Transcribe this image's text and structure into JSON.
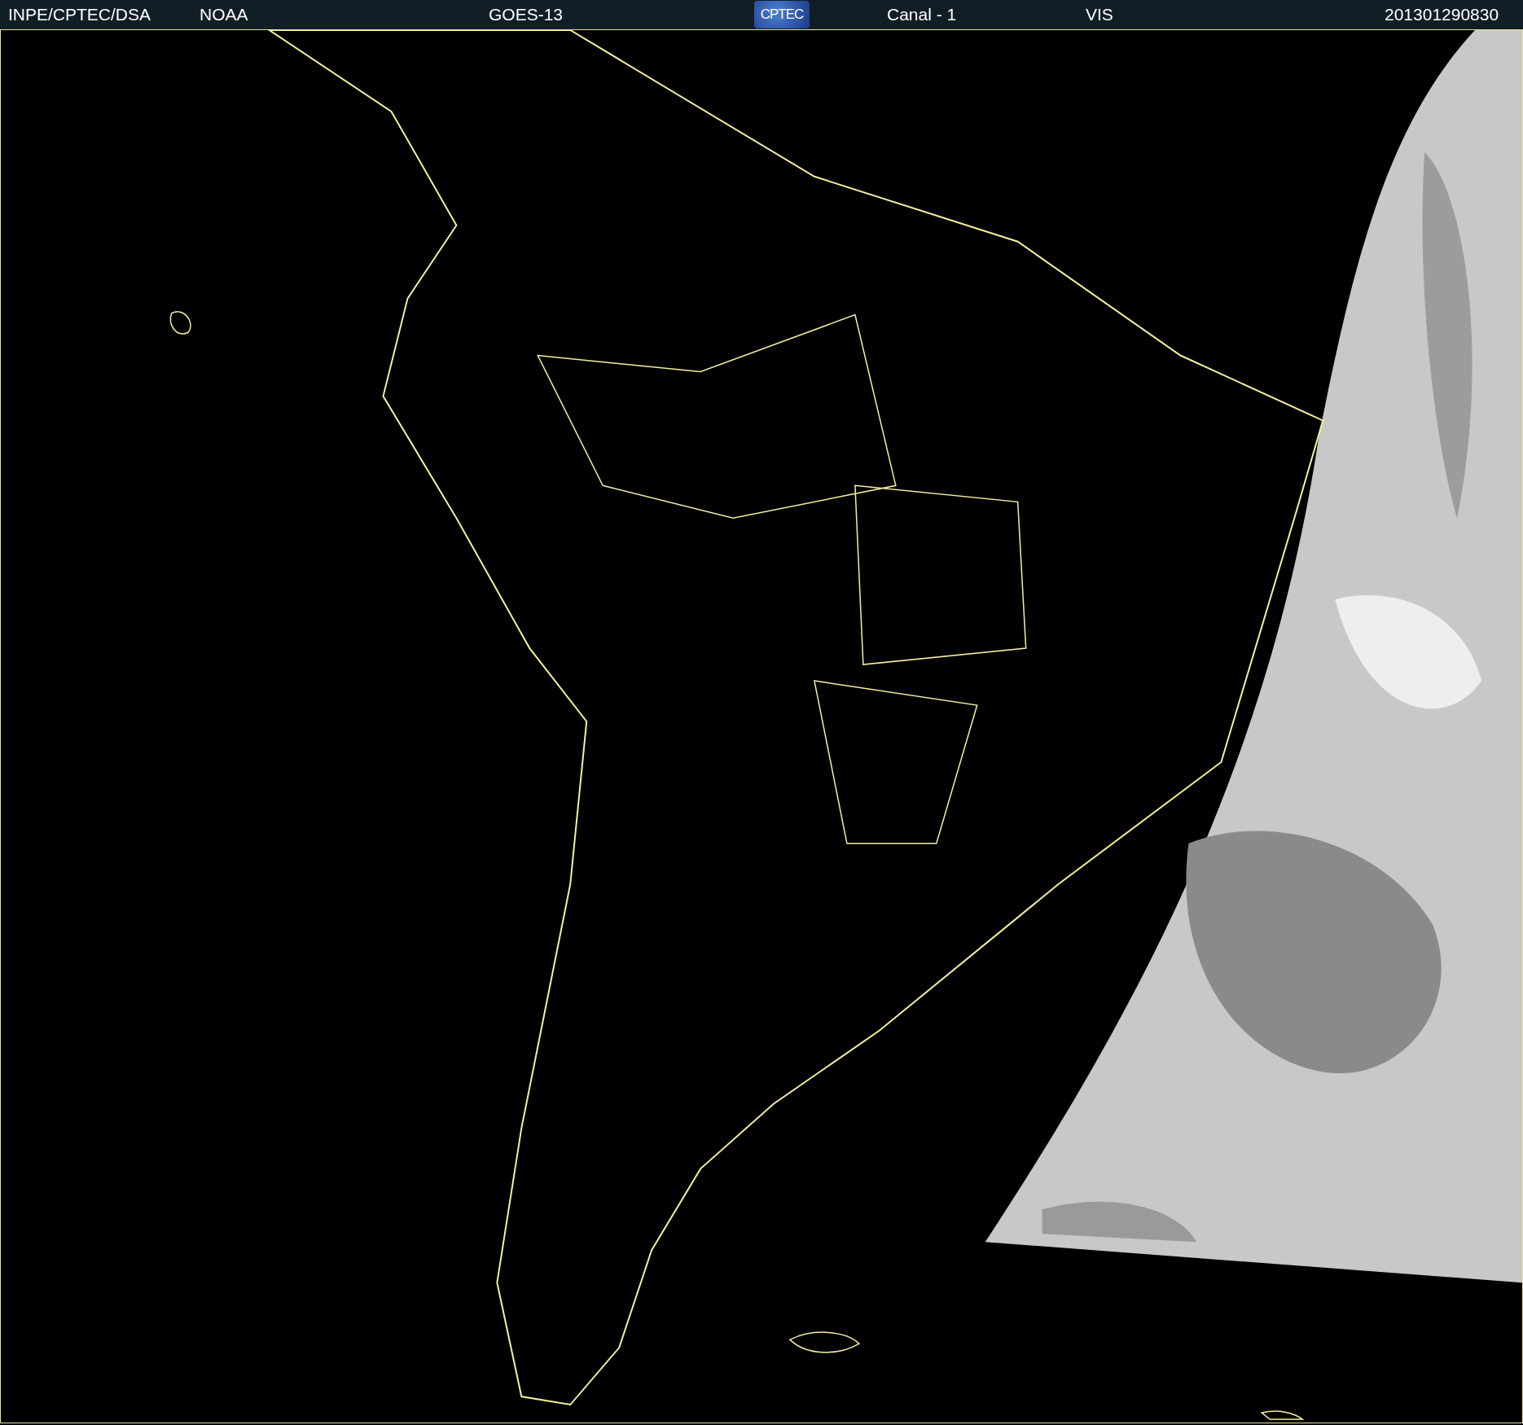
{
  "header": {
    "items": [
      {
        "kind": "text",
        "text": "INPE/CPTEC/DSA"
      },
      {
        "kind": "text",
        "text": "NOAA"
      },
      {
        "kind": "text",
        "text": "GOES-13"
      },
      {
        "kind": "logo",
        "text": "CPTEC"
      },
      {
        "kind": "text",
        "text": "Canal - 1"
      },
      {
        "kind": "text",
        "text": "VIS"
      },
      {
        "kind": "text",
        "text": "201301290830"
      }
    ]
  }
}
